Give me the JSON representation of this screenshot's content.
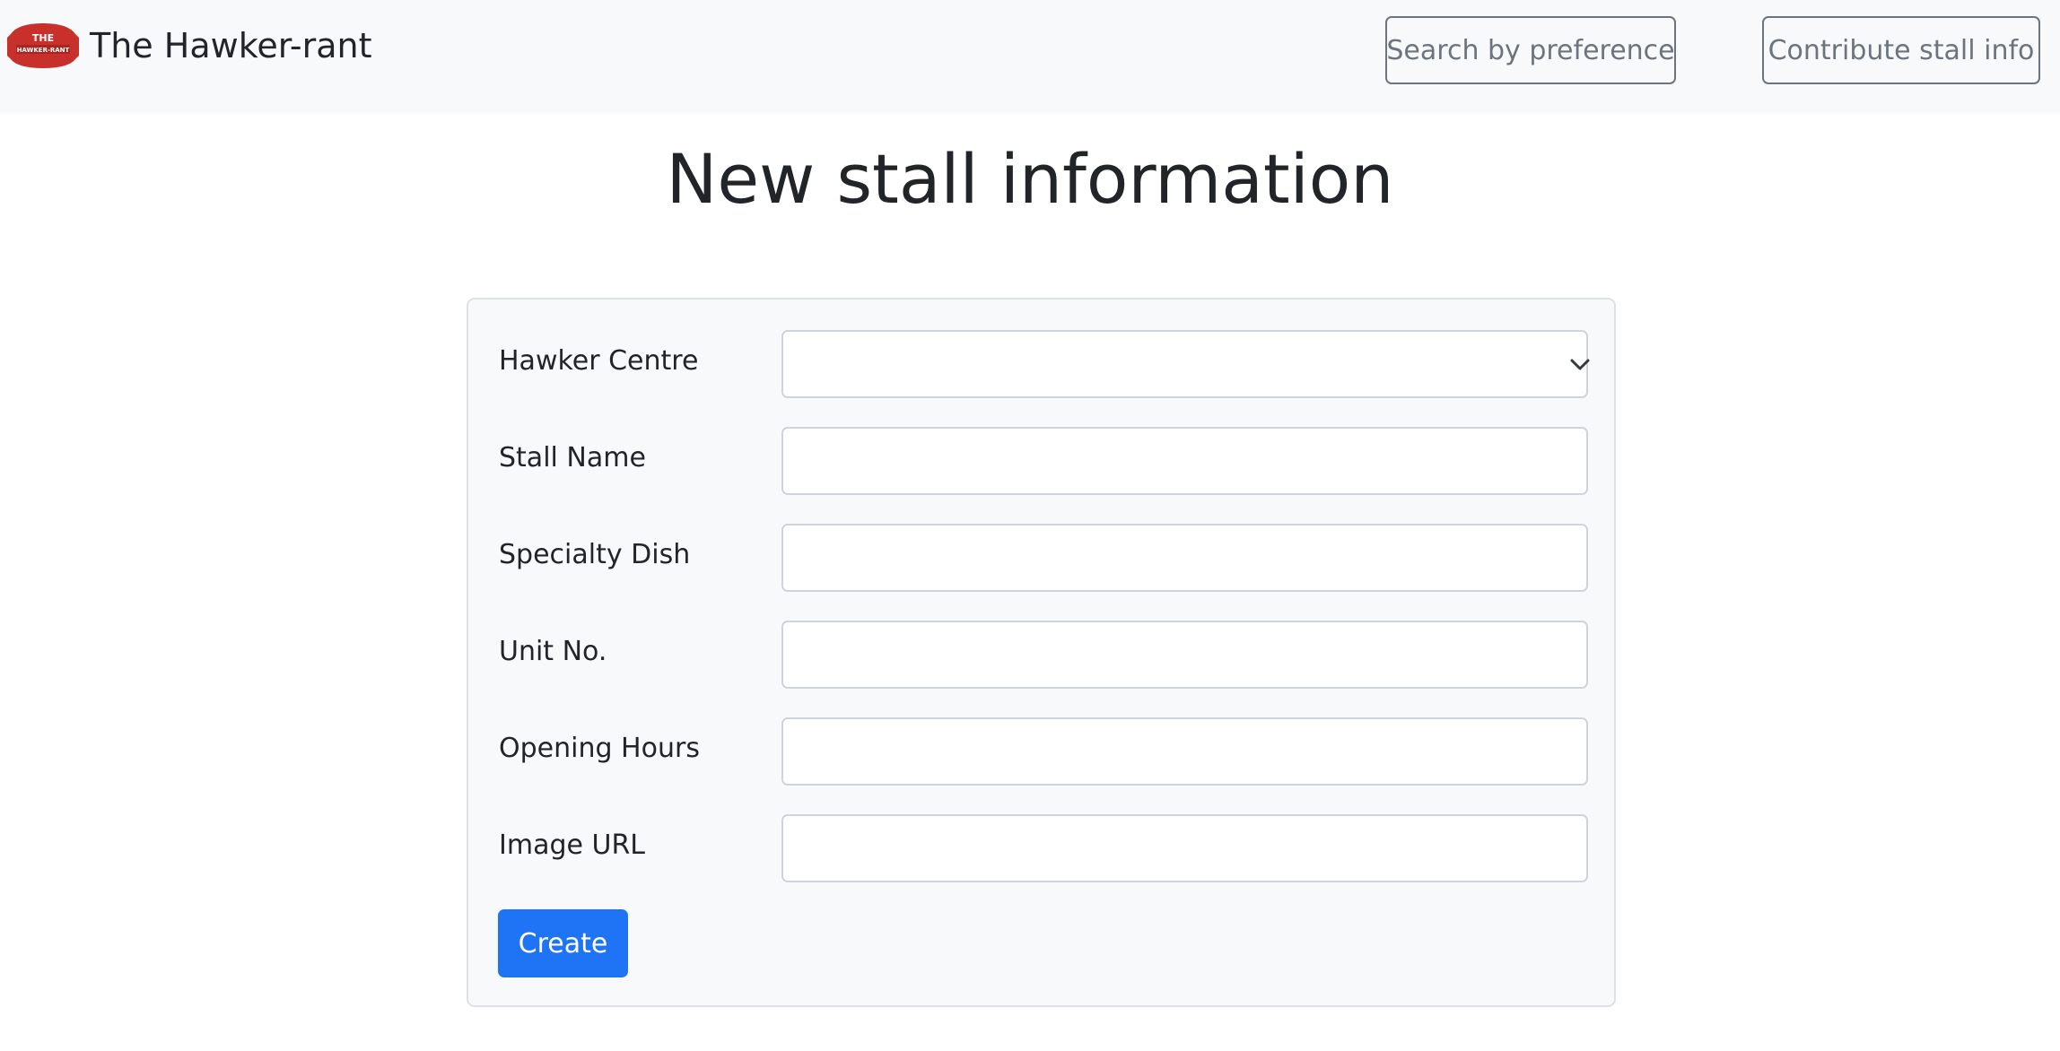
{
  "navbar": {
    "brand_title": "The Hawker-rant",
    "logo_text_top": "THE",
    "logo_text_bottom": "HAWKER-RANT",
    "logo_color": "#c8312b",
    "search_button_label": "Search by preference",
    "contribute_button_label": "Contribute stall info"
  },
  "page": {
    "title": "New stall information"
  },
  "form": {
    "fields": [
      {
        "label": "Hawker Centre",
        "type": "select",
        "value": ""
      },
      {
        "label": "Stall Name",
        "type": "text",
        "value": ""
      },
      {
        "label": "Specialty Dish",
        "type": "text",
        "value": ""
      },
      {
        "label": "Unit No.",
        "type": "text",
        "value": ""
      },
      {
        "label": "Opening Hours",
        "type": "text",
        "value": ""
      },
      {
        "label": "Image URL",
        "type": "text",
        "value": ""
      }
    ],
    "submit_label": "Create",
    "submit_color": "#1f74f6"
  }
}
